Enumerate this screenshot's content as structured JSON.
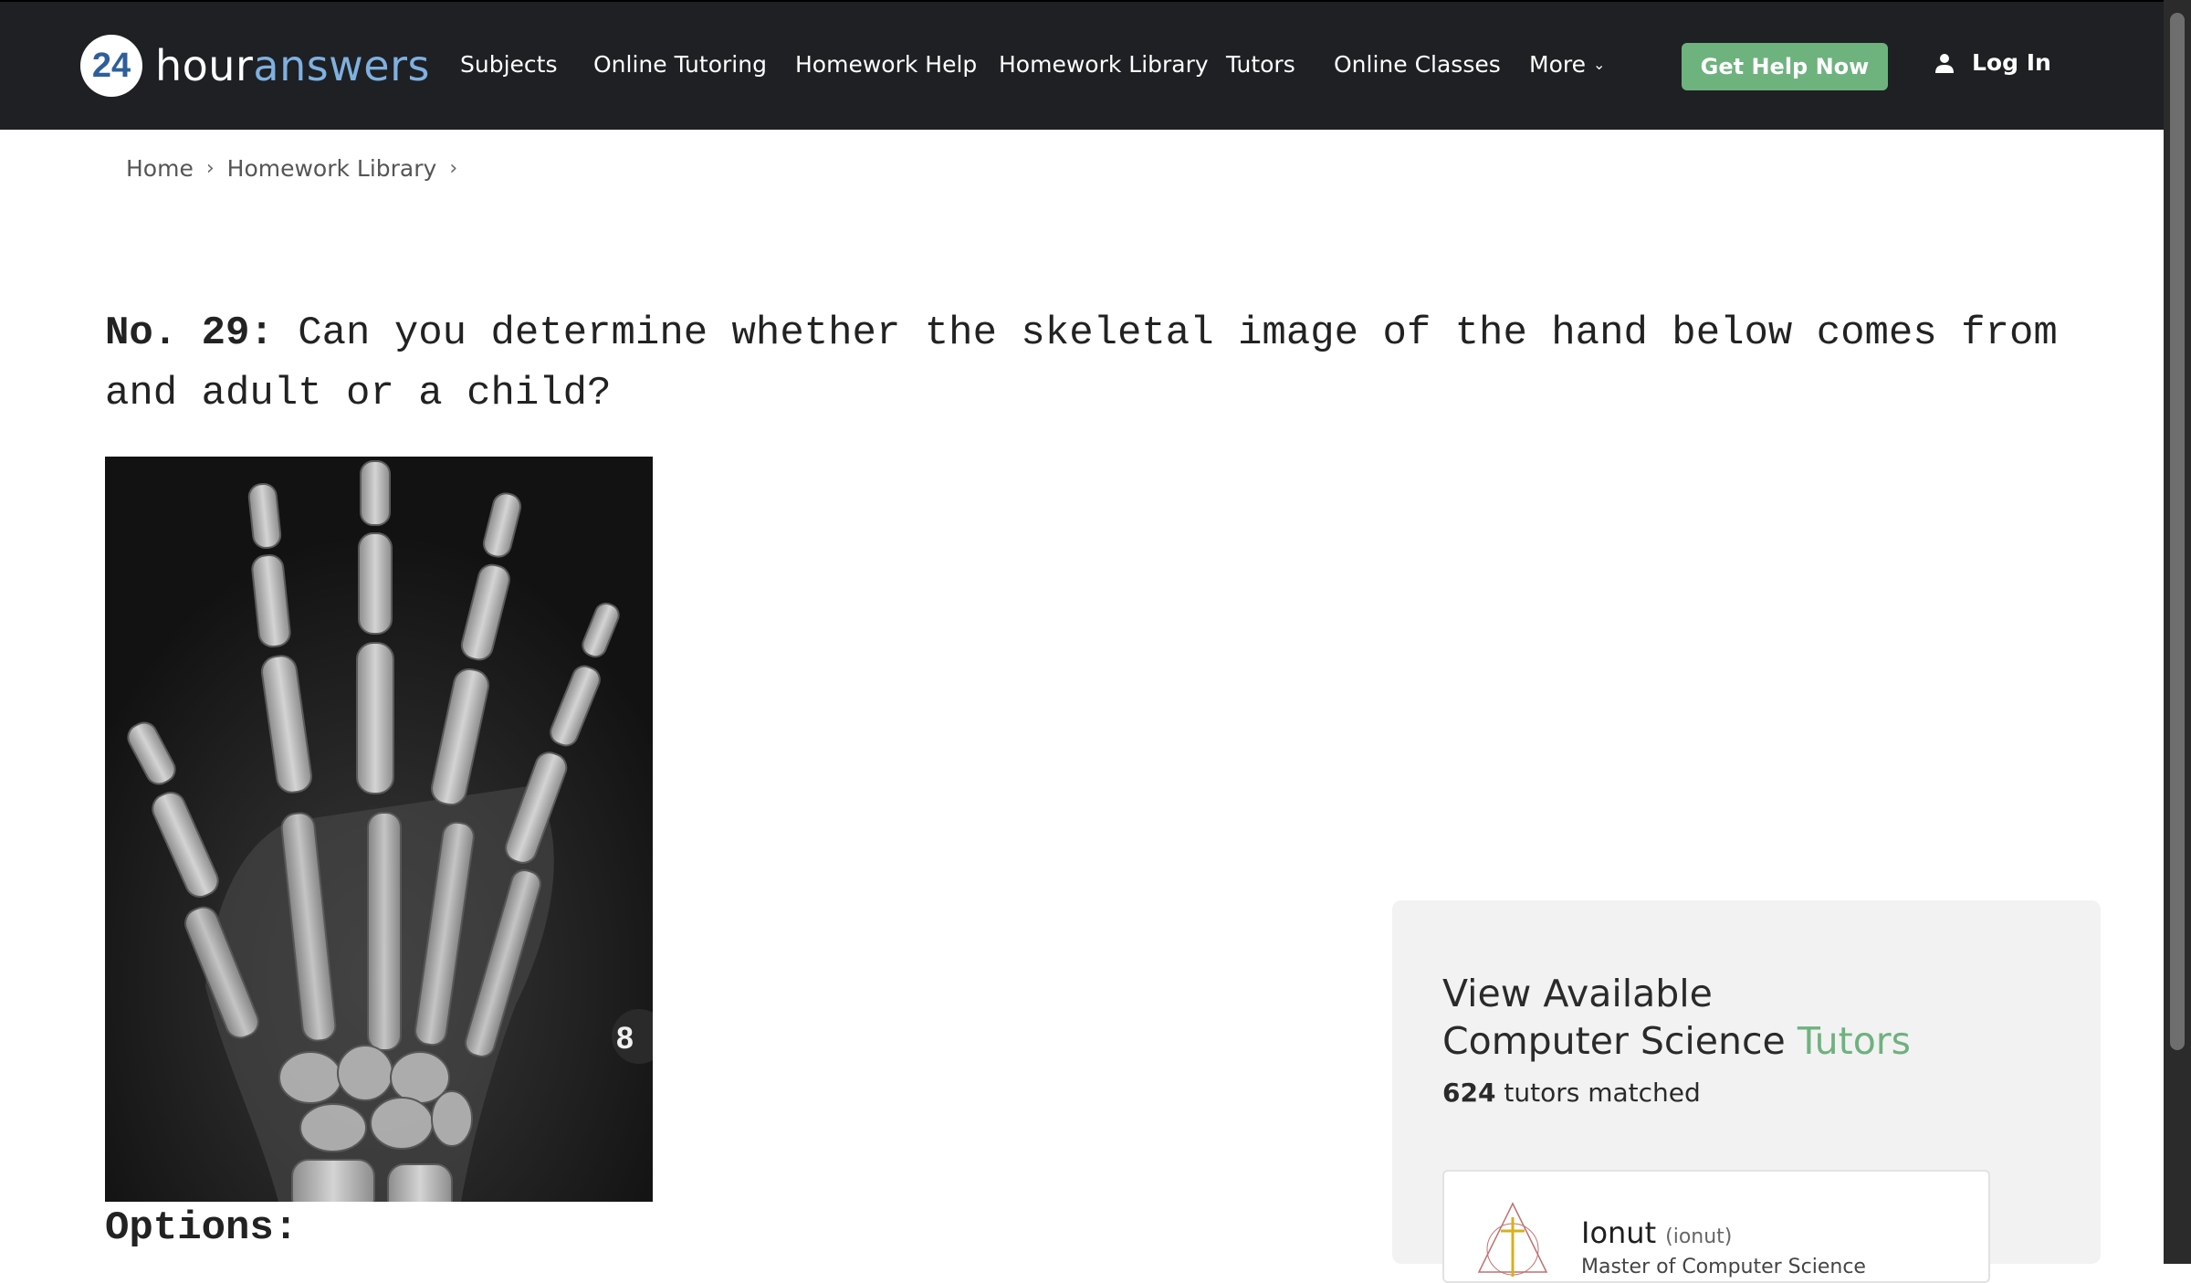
{
  "header": {
    "logo_number": "24",
    "logo_word_1": "hour",
    "logo_word_2": "answers",
    "nav": [
      {
        "label": "Subjects"
      },
      {
        "label": "Online Tutoring"
      },
      {
        "label": "Homework Help"
      },
      {
        "label": "Homework Library"
      },
      {
        "label": "Tutors"
      },
      {
        "label": "Online Classes"
      },
      {
        "label": "More"
      }
    ],
    "cta_label": "Get Help Now",
    "login_label": "Log In"
  },
  "breadcrumb": {
    "items": [
      "Home",
      "Homework Library"
    ],
    "separator": "›"
  },
  "question": {
    "prefix": "No. 29:",
    "text": "Can you determine whether the skeletal image of the hand below comes from and adult or a child?"
  },
  "options_label": "Options:",
  "tutor_panel": {
    "title_line1": "View Available",
    "title_line2_main": "Computer Science",
    "title_line2_accent": "Tutors",
    "matched_count": "624",
    "matched_suffix": "tutors matched",
    "tutor": {
      "name": "Ionut",
      "handle": "(ionut)",
      "degree": "Master of Computer Science"
    }
  },
  "colors": {
    "header_bg": "#1e2023",
    "accent_green": "#6eb27e",
    "logo_blue": "#7fb0e0"
  }
}
